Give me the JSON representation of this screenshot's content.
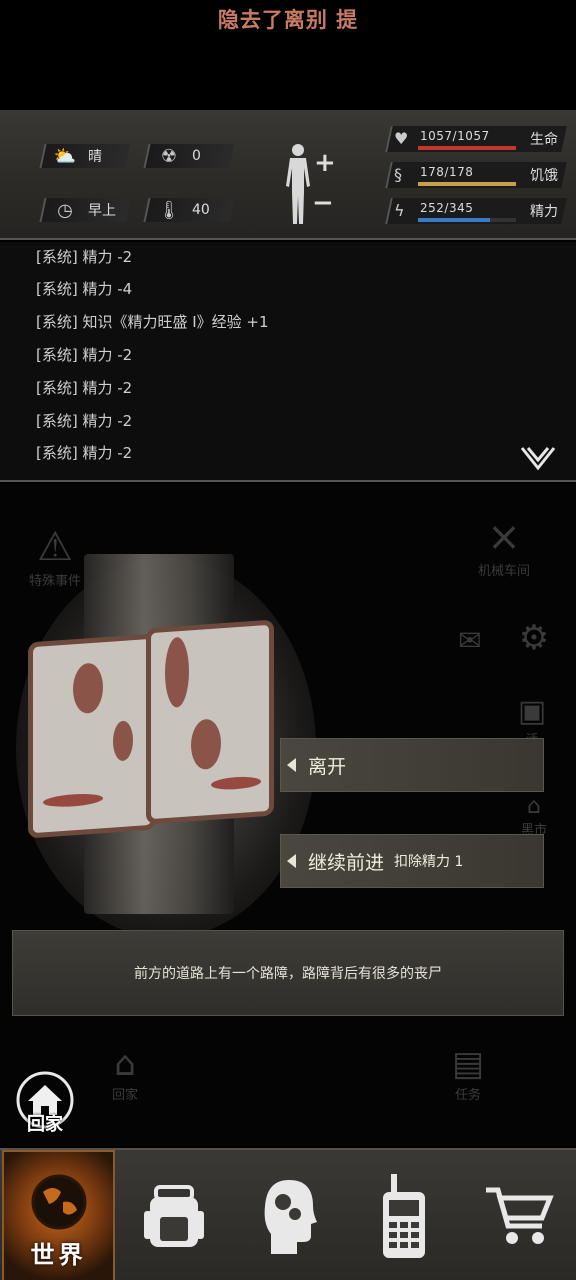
{
  "top_notice": "隐去了离别 提",
  "status": {
    "weather": {
      "icon": "cloud-sun-icon",
      "value": "晴"
    },
    "radiation": {
      "icon": "radiation-icon",
      "value": "0"
    },
    "time": {
      "icon": "clock-icon",
      "value": "早上"
    },
    "temperature": {
      "icon": "thermometer-icon",
      "value": "40"
    },
    "health": {
      "label": "生命",
      "value": "1057/1057",
      "fraction": 1.0,
      "color": "#c0392b"
    },
    "hunger": {
      "label": "饥饿",
      "value": "178/178",
      "fraction": 1.0,
      "color": "#c9a04a"
    },
    "energy": {
      "label": "精力",
      "value": "252/345",
      "fraction": 0.73,
      "color": "#3a7bc8"
    }
  },
  "log": [
    "[系统] 精力 -2",
    "[系统] 精力 -4",
    "[系统] 知识《精力旺盛 Ⅰ》经验 +1",
    "[系统] 精力 -2",
    "[系统] 精力 -2",
    "[系统] 精力 -2",
    "[系统] 精力 -2"
  ],
  "side": {
    "special_event": "特殊事件",
    "workshop": "机械车间",
    "gift_partial": "活",
    "black_market": "黑市",
    "home_ghost": "回家",
    "task": "任务"
  },
  "actions": {
    "leave": "离开",
    "continue": "继续前进",
    "continue_cost": "扣除精力 1"
  },
  "description": "前方的道路上有一个路障，路障背后有很多的丧尸",
  "home_button": "回家",
  "nav": {
    "world": "世界",
    "items": [
      "world-globe-icon",
      "backpack-icon",
      "head-gears-icon",
      "radio-icon",
      "cart-icon"
    ]
  }
}
